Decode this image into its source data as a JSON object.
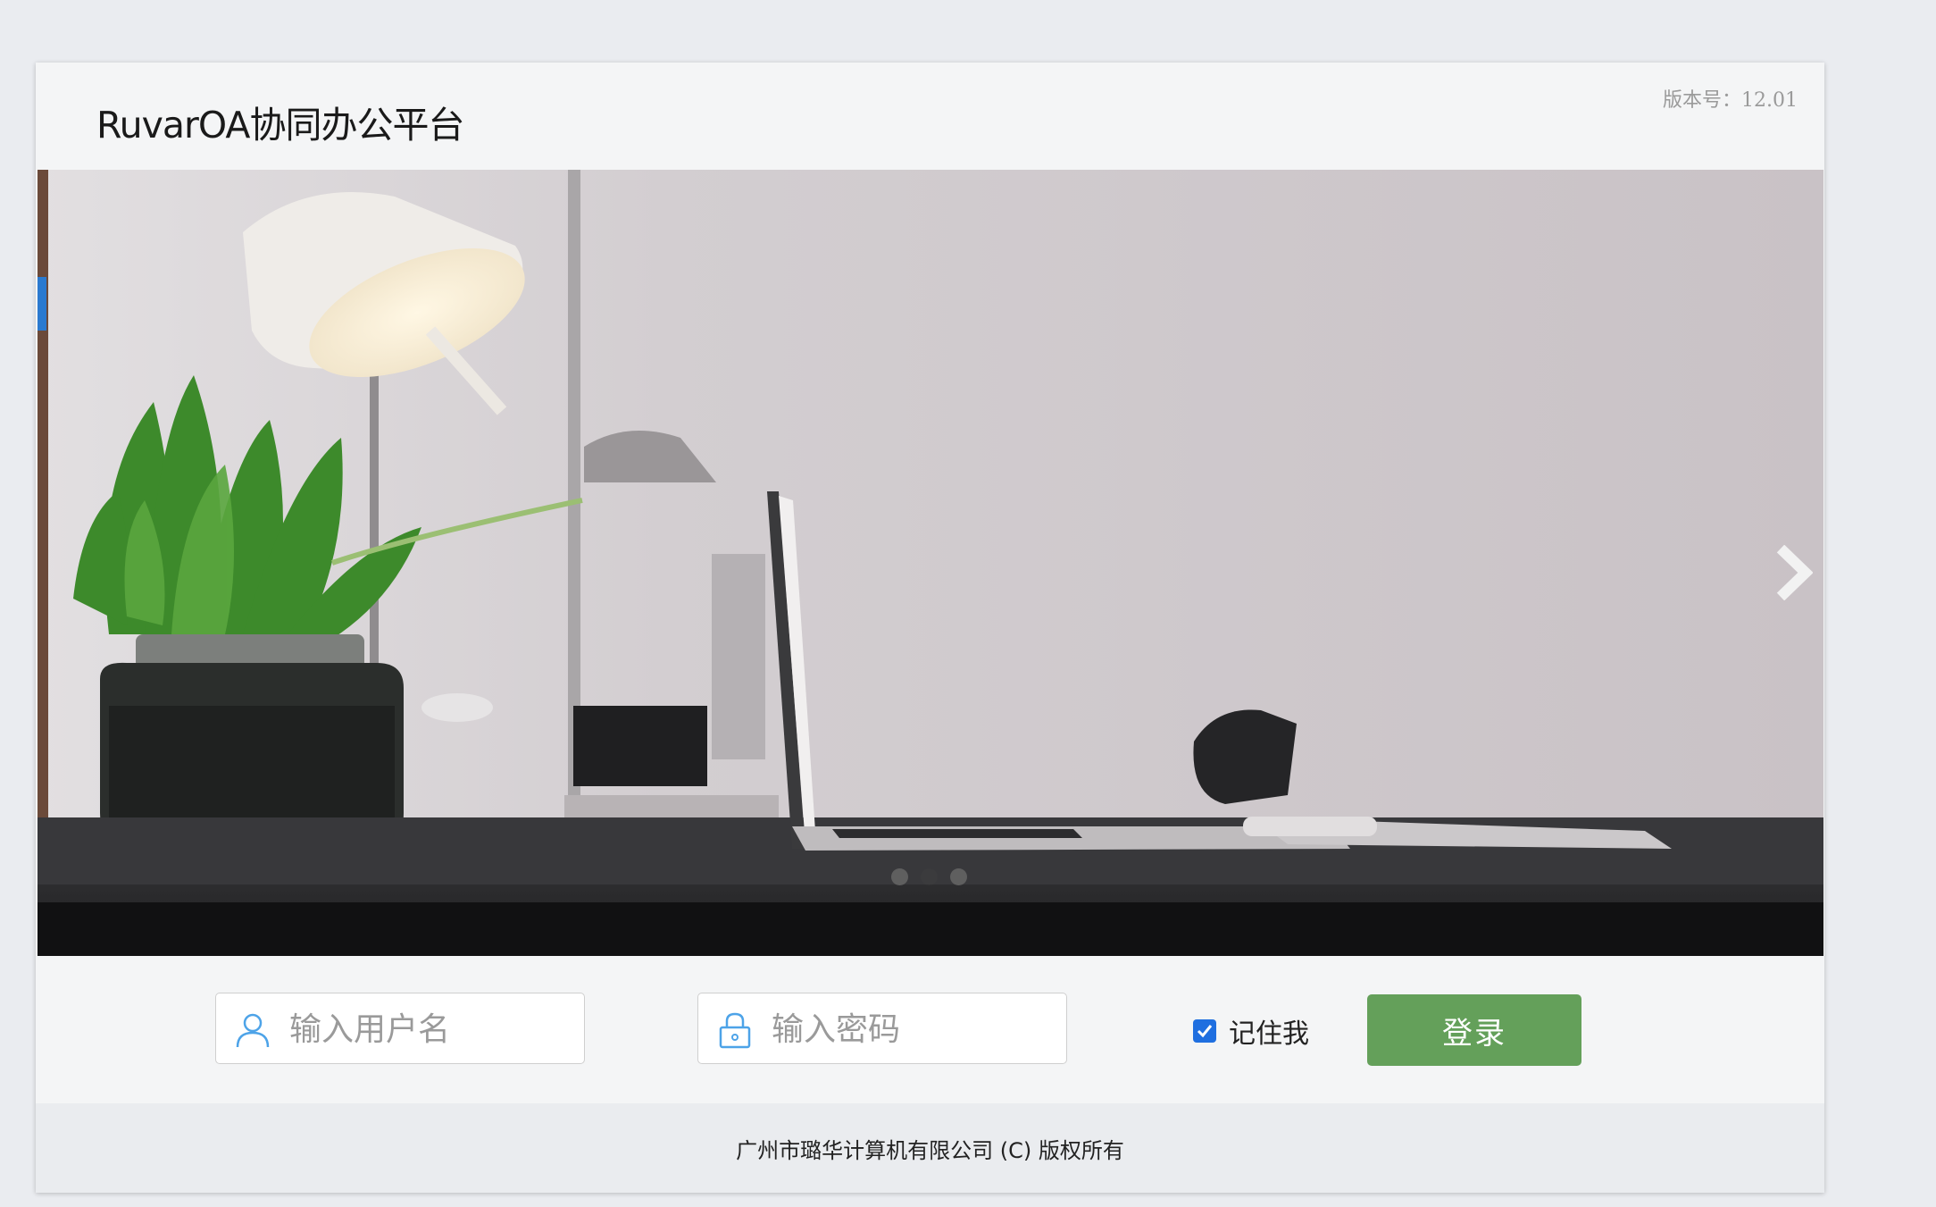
{
  "header": {
    "title": "RuvarOA协同办公平台",
    "version": "版本号：12.01"
  },
  "carousel": {
    "slide_count": 3,
    "active_index": 1,
    "next_icon": "chevron-right-icon"
  },
  "login": {
    "username_placeholder": "输入用户名",
    "password_placeholder": "输入密码",
    "username_icon": "user-icon",
    "password_icon": "lock-icon",
    "remember_label": "记住我",
    "remember_checked": true,
    "submit_label": "登录",
    "accent_color": "#64a05a",
    "checkbox_color": "#1f6fe0"
  },
  "footer": {
    "copyright": "广州市璐华计算机有限公司 (C) 版权所有"
  }
}
